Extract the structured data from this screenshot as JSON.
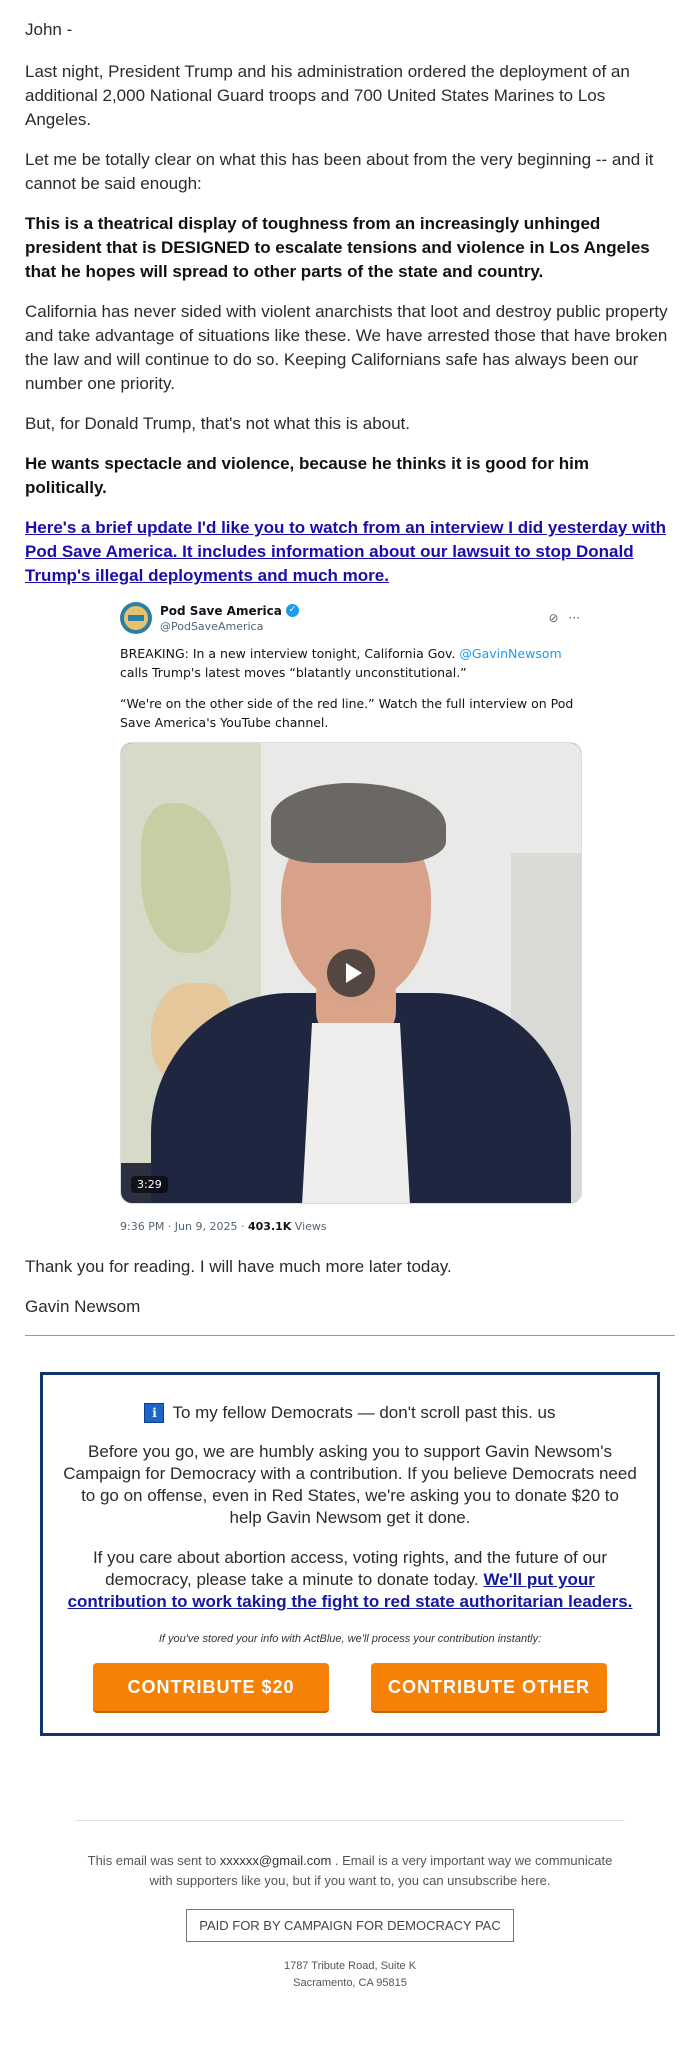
{
  "email": {
    "greeting": "John -",
    "p1": "Last night, President Trump and his administration ordered the deployment of an additional 2,000 National Guard troops and 700 United States Marines to Los Angeles.",
    "p2": "Let me be totally clear on what this has been about from the very beginning -- and it cannot be said enough:",
    "p3_bold": "This is a theatrical display of toughness from an increasingly unhinged president that is DESIGNED to escalate tensions and violence in Los Angeles that he hopes will spread to other parts of the state and country.",
    "p4": "California has never sided with violent anarchists that loot and destroy public property and take advantage of situations like these. We have arrested those that have broken the law and will continue to do so. Keeping Californians safe has always been our number one priority.",
    "p5": "But, for Donald Trump, that's not what this is about.",
    "p6_bold": "He wants spectacle and violence, because he thinks it is good for him politically.",
    "link_text": "Here's a brief update I'd like you to watch from an interview I did yesterday with Pod Save America. It includes information about our lawsuit to stop Donald Trump's illegal deployments and much more.",
    "closing": "Thank you for reading. I will have much more later today.",
    "signature": "Gavin Newsom"
  },
  "tweet": {
    "name": "Pod Save America",
    "handle": "@PodSaveAmerica",
    "text1_before": "BREAKING: In a new interview tonight, California Gov. ",
    "mention": "@GavinNewsom",
    "text1_after": " calls Trump's latest moves “blatantly unconstitutional.”",
    "text2": "“We're on the other side of the red line.” Watch the full interview on Pod Save America's YouTube channel.",
    "duration": "3:29",
    "timestamp": "9:36 PM · Jun 9, 2025 · ",
    "views_count": "403.1K",
    "views_label": " Views",
    "icons": [
      "grok-icon",
      "more-icon"
    ]
  },
  "promo": {
    "title": "To my fellow Democrats — don't scroll past this. us",
    "p1": "Before you go, we are humbly asking you to support Gavin Newsom's Campaign for Democracy with a contribution. If you believe Democrats need to go on offense, even in Red States, we're asking you to donate $20 to help Gavin Newsom get it done.",
    "p2_before": "If you care about abortion access, voting rights, and the future of our democracy, please take a minute to donate today. ",
    "p2_link": "We'll put your contribution to work taking the fight to red state authoritarian leaders.",
    "note": "If you've stored your info with ActBlue, we'll process your contribution instantly:",
    "btn1": "CONTRIBUTE $20",
    "btn2": "CONTRIBUTE OTHER",
    "button_color": "#f58207",
    "border_color": "#10346b"
  },
  "footer": {
    "sent_before": "This email was sent to ",
    "email": "xxxxxx@gmail.com",
    "sent_after": " . Email is a very important way we communicate with supporters like you, but if you want to, you can unsubscribe here.",
    "paid_for": "PAID FOR BY CAMPAIGN FOR DEMOCRACY PAC",
    "address_line1": "1787 Tribute Road, Suite K",
    "address_line2": "Sacramento, CA 95815"
  }
}
